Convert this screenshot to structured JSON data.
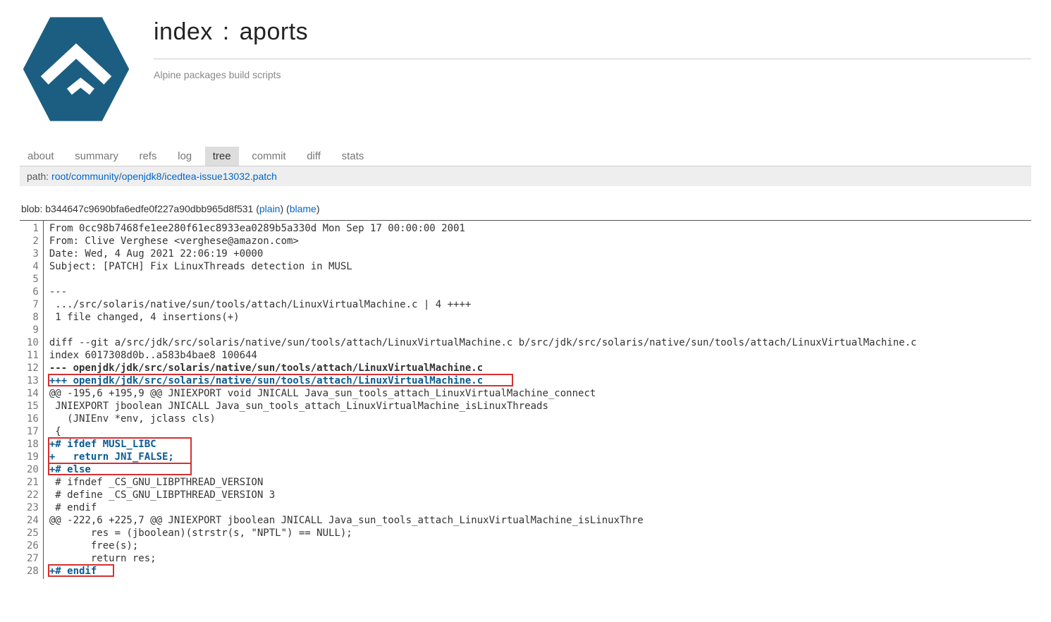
{
  "title_index": "index",
  "title_sep": ":",
  "title_repo": "aports",
  "subtitle": "Alpine packages build scripts",
  "tabs": {
    "about": "about",
    "summary": "summary",
    "refs": "refs",
    "log": "log",
    "tree": "tree",
    "commit": "commit",
    "diff": "diff",
    "stats": "stats"
  },
  "path": {
    "label": "path: ",
    "root": "root",
    "community": "community",
    "openjdk8": "openjdk8",
    "file": "icedtea-issue13032.patch"
  },
  "blob": {
    "label": "blob: ",
    "sha": "b344647c9690bfa6edfe0f227a90dbb965d8f531",
    "plain": "plain",
    "blame": "blame"
  },
  "lines": [
    {
      "n": 1,
      "text": "From 0cc98b7468fe1ee280f61ec8933ea0289b5a330d Mon Sep 17 00:00:00 2001",
      "cls": ""
    },
    {
      "n": 2,
      "text": "From: Clive Verghese <verghese@amazon.com>",
      "cls": ""
    },
    {
      "n": 3,
      "text": "Date: Wed, 4 Aug 2021 22:06:19 +0000",
      "cls": ""
    },
    {
      "n": 4,
      "text": "Subject: [PATCH] Fix LinuxThreads detection in MUSL",
      "cls": ""
    },
    {
      "n": 5,
      "text": "",
      "cls": ""
    },
    {
      "n": 6,
      "text": "---",
      "cls": ""
    },
    {
      "n": 7,
      "text": " .../src/solaris/native/sun/tools/attach/LinuxVirtualMachine.c | 4 ++++",
      "cls": ""
    },
    {
      "n": 8,
      "text": " 1 file changed, 4 insertions(+)",
      "cls": ""
    },
    {
      "n": 9,
      "text": "",
      "cls": ""
    },
    {
      "n": 10,
      "text": "diff --git a/src/jdk/src/solaris/native/sun/tools/attach/LinuxVirtualMachine.c b/src/jdk/src/solaris/native/sun/tools/attach/LinuxVirtualMachine.c",
      "cls": ""
    },
    {
      "n": 11,
      "text": "index 6017308d0b..a583b4bae8 100644",
      "cls": ""
    },
    {
      "n": 12,
      "text": "--- openjdk/jdk/src/solaris/native/sun/tools/attach/LinuxVirtualMachine.c",
      "cls": "bold"
    },
    {
      "n": 13,
      "text": "+++ openjdk/jdk/src/solaris/native/sun/tools/attach/LinuxVirtualMachine.c",
      "cls": "newfile",
      "hlw": 660
    },
    {
      "n": 14,
      "text": "@@ -195,6 +195,9 @@ JNIEXPORT void JNICALL Java_sun_tools_attach_LinuxVirtualMachine_connect",
      "cls": ""
    },
    {
      "n": 15,
      "text": " JNIEXPORT jboolean JNICALL Java_sun_tools_attach_LinuxVirtualMachine_isLinuxThreads",
      "cls": ""
    },
    {
      "n": 16,
      "text": "   (JNIEnv *env, jclass cls)",
      "cls": ""
    },
    {
      "n": 17,
      "text": " {",
      "cls": ""
    },
    {
      "n": 18,
      "text": "+# ifdef MUSL_LIBC",
      "cls": "add",
      "hltop": true
    },
    {
      "n": 19,
      "text": "+   return JNI_FALSE;",
      "cls": "add",
      "hlmid": true
    },
    {
      "n": 20,
      "text": "+# else",
      "cls": "add",
      "hlbot": true,
      "hlw": 204
    },
    {
      "n": 21,
      "text": " # ifndef _CS_GNU_LIBPTHREAD_VERSION",
      "cls": ""
    },
    {
      "n": 22,
      "text": " # define _CS_GNU_LIBPTHREAD_VERSION 3",
      "cls": ""
    },
    {
      "n": 23,
      "text": " # endif",
      "cls": ""
    },
    {
      "n": 24,
      "text": "@@ -222,6 +225,7 @@ JNIEXPORT jboolean JNICALL Java_sun_tools_attach_LinuxVirtualMachine_isLinuxThre",
      "cls": ""
    },
    {
      "n": 25,
      "text": "       res = (jboolean)(strstr(s, \"NPTL\") == NULL);",
      "cls": ""
    },
    {
      "n": 26,
      "text": "       free(s);",
      "cls": ""
    },
    {
      "n": 27,
      "text": "       return res;",
      "cls": ""
    },
    {
      "n": 28,
      "text": "+# endif",
      "cls": "add",
      "hlw": 94
    }
  ]
}
